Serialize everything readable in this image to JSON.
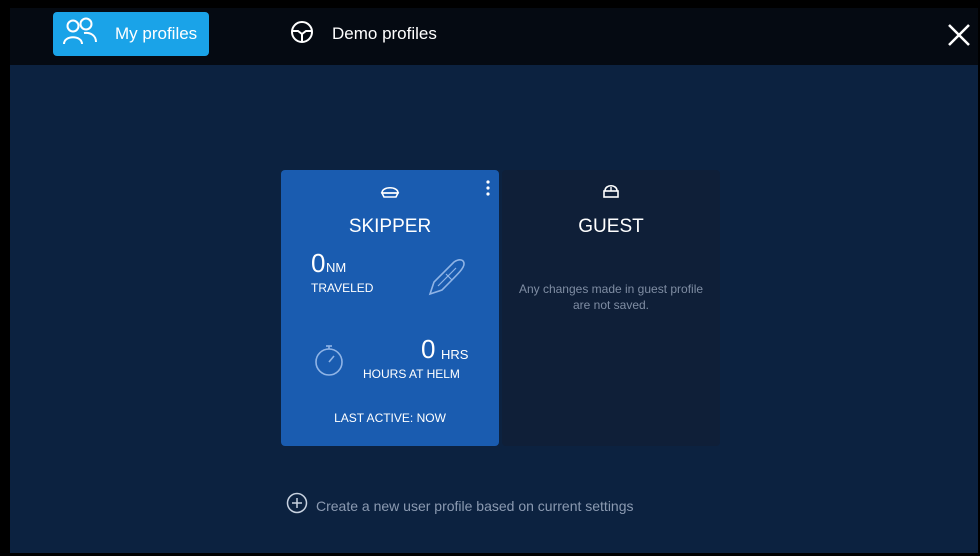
{
  "tabs": {
    "my_profiles": "My profiles",
    "demo_profiles": "Demo profiles"
  },
  "skipper": {
    "title": "SKIPPER",
    "distance_value": "0",
    "distance_unit": "NM",
    "distance_label": "TRAVELED",
    "hours_value": "0",
    "hours_unit": "HRS",
    "hours_label": "HOURS AT HELM",
    "last_active": "LAST ACTIVE: NOW"
  },
  "guest": {
    "title": "GUEST",
    "message": "Any changes made in guest profile are not saved."
  },
  "create_profile_label": "Create a new user profile based on current settings",
  "colors": {
    "accent": "#1aa3e8",
    "skipper_card": "#1a5cb0",
    "guest_card": "#0f1f38",
    "background": "#0c2240"
  }
}
